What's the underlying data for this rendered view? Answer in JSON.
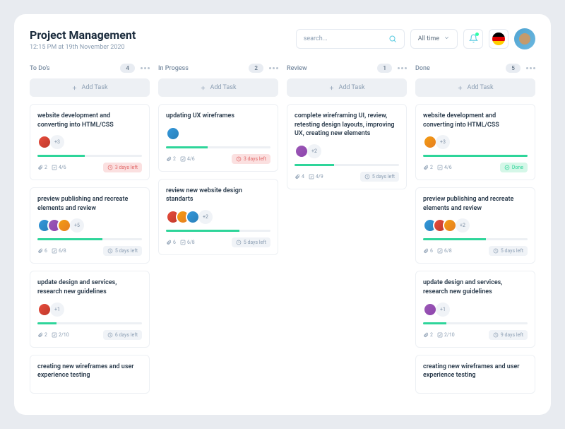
{
  "header": {
    "title": "Project Management",
    "subtitle": "12:15 PM at 19th November 2020",
    "search_placeholder": "search...",
    "time_filter": "All time"
  },
  "add_task_label": "Add Task",
  "columns": [
    {
      "title": "To Do's",
      "count": "4",
      "cards": [
        {
          "title": "website development and converting into HTML/CSS",
          "avatars": [
            "av1"
          ],
          "more": "+3",
          "progress": 45,
          "attachments": "2",
          "checks": "4/6",
          "status": {
            "type": "danger",
            "label": "3 days left"
          }
        },
        {
          "title": "preview publishing and recreate elements and review",
          "avatars": [
            "av2",
            "av4",
            "av3"
          ],
          "more": "+5",
          "progress": 62,
          "attachments": "6",
          "checks": "6/8",
          "status": {
            "type": "neutral",
            "label": "5 days left"
          }
        },
        {
          "title": "update design and services, research new guidelines",
          "avatars": [
            "av1"
          ],
          "more": "+1",
          "progress": 18,
          "attachments": "2",
          "checks": "2/10",
          "status": {
            "type": "neutral",
            "label": "6 days left"
          }
        },
        {
          "title": "creating new wireframes and user experience testing",
          "avatars": [],
          "more": "",
          "progress": 0,
          "attachments": "",
          "checks": "",
          "status": null
        }
      ]
    },
    {
      "title": "In Progess",
      "count": "2",
      "cards": [
        {
          "title": "updating UX wireframes",
          "avatars": [
            "av2"
          ],
          "more": "",
          "progress": 40,
          "attachments": "2",
          "checks": "4/6",
          "status": {
            "type": "danger",
            "label": "3 days left"
          }
        },
        {
          "title": "review new website design standarts",
          "avatars": [
            "av1",
            "av3",
            "av2"
          ],
          "more": "+2",
          "progress": 70,
          "attachments": "6",
          "checks": "6/8",
          "status": {
            "type": "neutral",
            "label": "5 days left"
          }
        }
      ]
    },
    {
      "title": "Review",
      "count": "1",
      "cards": [
        {
          "title": "complete wireframing UI, review, retesting design layouts, improving UX, creating new elements",
          "avatars": [
            "av4"
          ],
          "more": "+2",
          "progress": 38,
          "attachments": "4",
          "checks": "4/9",
          "status": {
            "type": "neutral",
            "label": "5 days left"
          }
        }
      ]
    },
    {
      "title": "Done",
      "count": "5",
      "cards": [
        {
          "title": "website development and converting into HTML/CSS",
          "avatars": [
            "av3"
          ],
          "more": "+3",
          "progress": 100,
          "attachments": "2",
          "checks": "4/6",
          "status": {
            "type": "done",
            "label": "Done"
          }
        },
        {
          "title": "preview publishing and recreate elements and review",
          "avatars": [
            "av2",
            "av1",
            "av3"
          ],
          "more": "+2",
          "progress": 60,
          "attachments": "6",
          "checks": "6/8",
          "status": {
            "type": "neutral",
            "label": "5 days left"
          }
        },
        {
          "title": "update design and services, research new guidelines",
          "avatars": [
            "av4"
          ],
          "more": "+1",
          "progress": 22,
          "attachments": "2",
          "checks": "2/10",
          "status": {
            "type": "neutral",
            "label": "9 days left"
          }
        },
        {
          "title": "creating new wireframes and user experience testing",
          "avatars": [],
          "more": "",
          "progress": 0,
          "attachments": "",
          "checks": "",
          "status": null
        }
      ]
    }
  ]
}
